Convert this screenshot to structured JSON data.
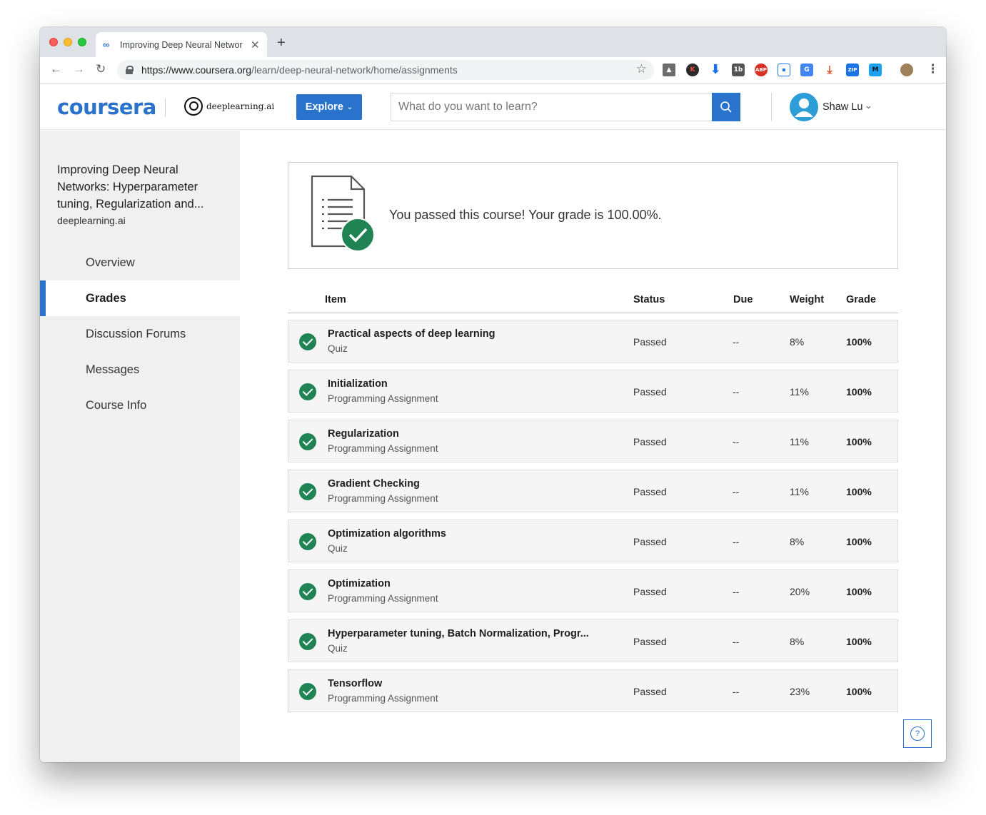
{
  "browser": {
    "tab_title": "Improving Deep Neural Networ",
    "new_tab": "+",
    "url_host": "https://www.coursera.org",
    "url_path": "/learn/deep-neural-network/home/assignments"
  },
  "header": {
    "logo": "coursera",
    "partner_logo": "deeplearning.ai",
    "explore_label": "Explore",
    "search_placeholder": "What do you want to learn?",
    "user_name": "Shaw Lu"
  },
  "sidebar": {
    "course_title": "Improving Deep Neural Networks: Hyperparameter tuning, Regularization and...",
    "partner": "deeplearning.ai",
    "items": [
      {
        "label": "Overview",
        "active": false
      },
      {
        "label": "Grades",
        "active": true
      },
      {
        "label": "Discussion Forums",
        "active": false
      },
      {
        "label": "Messages",
        "active": false
      },
      {
        "label": "Course Info",
        "active": false
      }
    ]
  },
  "main": {
    "pass_message": "You passed this course! Your grade is 100.00%.",
    "columns": {
      "item": "Item",
      "status": "Status",
      "due": "Due",
      "weight": "Weight",
      "grade": "Grade"
    },
    "rows": [
      {
        "name": "Practical aspects of deep learning",
        "type": "Quiz",
        "status": "Passed",
        "due": "--",
        "weight": "8%",
        "grade": "100%"
      },
      {
        "name": "Initialization",
        "type": "Programming Assignment",
        "status": "Passed",
        "due": "--",
        "weight": "11%",
        "grade": "100%"
      },
      {
        "name": "Regularization",
        "type": "Programming Assignment",
        "status": "Passed",
        "due": "--",
        "weight": "11%",
        "grade": "100%"
      },
      {
        "name": "Gradient Checking",
        "type": "Programming Assignment",
        "status": "Passed",
        "due": "--",
        "weight": "11%",
        "grade": "100%"
      },
      {
        "name": "Optimization algorithms",
        "type": "Quiz",
        "status": "Passed",
        "due": "--",
        "weight": "8%",
        "grade": "100%"
      },
      {
        "name": "Optimization",
        "type": "Programming Assignment",
        "status": "Passed",
        "due": "--",
        "weight": "20%",
        "grade": "100%"
      },
      {
        "name": "Hyperparameter tuning, Batch Normalization, Progr...",
        "type": "Quiz",
        "status": "Passed",
        "due": "--",
        "weight": "8%",
        "grade": "100%"
      },
      {
        "name": "Tensorflow",
        "type": "Programming Assignment",
        "status": "Passed",
        "due": "--",
        "weight": "23%",
        "grade": "100%"
      }
    ],
    "help_label": "?"
  },
  "colors": {
    "brand": "#2a73cc",
    "passed": "#1f8354",
    "sidebar_bg": "#f0f0f0"
  }
}
